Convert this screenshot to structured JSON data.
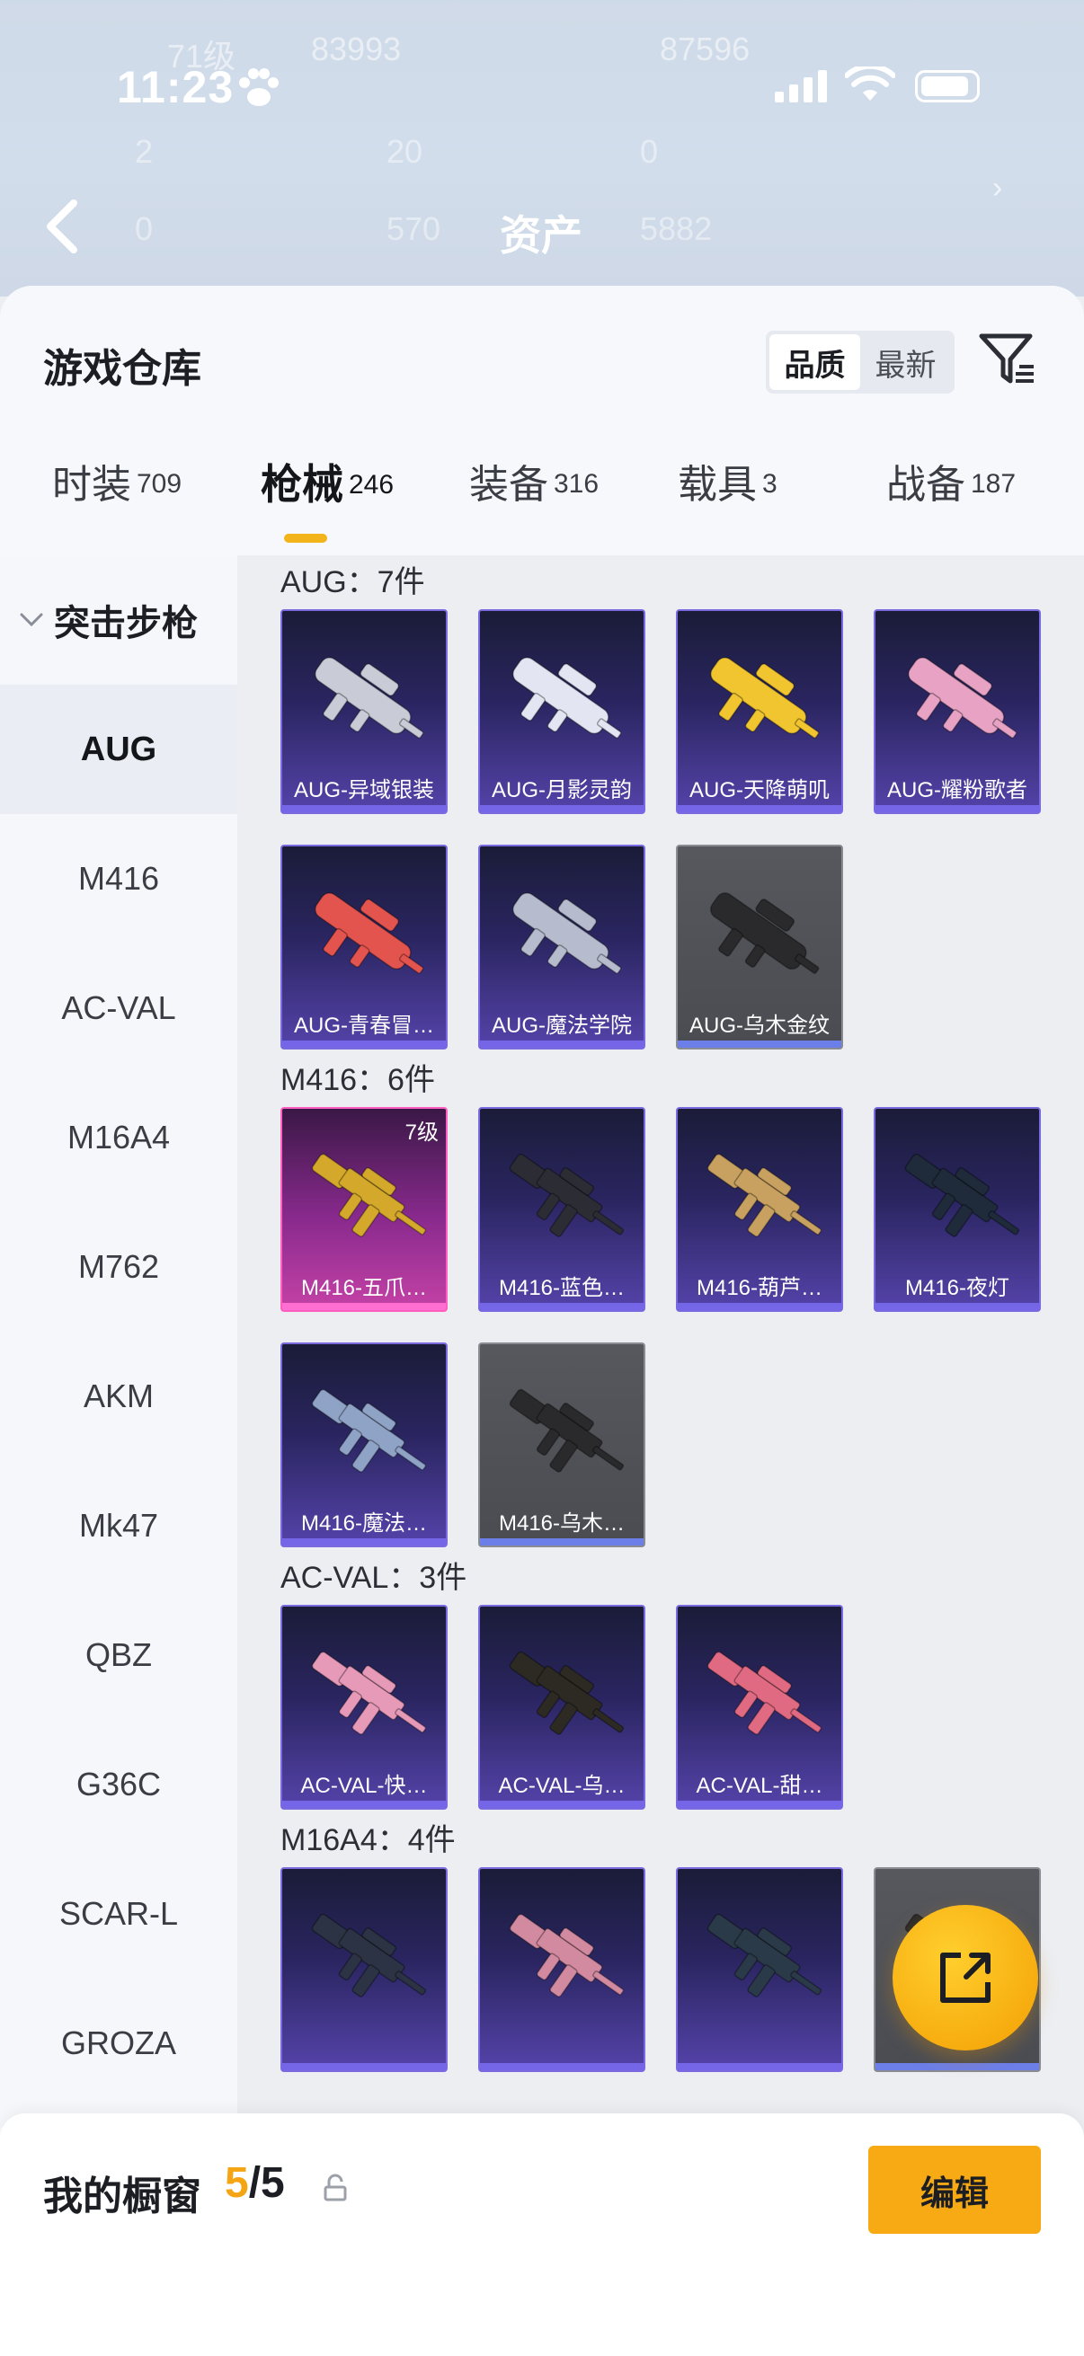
{
  "status_bar": {
    "time": "11:23"
  },
  "background": {
    "level": "71级",
    "stat_a": "83993",
    "stat_b": "87596",
    "row2": [
      "2",
      "20",
      "0"
    ],
    "row3_left": "0",
    "row3_mid": "570",
    "title": "资产",
    "row3_right": "5882"
  },
  "header": {
    "title": "游戏仓库",
    "sort": {
      "options": [
        "品质",
        "最新"
      ],
      "active": "品质"
    },
    "filter_icon": "filter-icon"
  },
  "tabs": [
    {
      "label": "时装",
      "count": "709",
      "active": false
    },
    {
      "label": "枪械",
      "count": "246",
      "active": true
    },
    {
      "label": "装备",
      "count": "316",
      "active": false
    },
    {
      "label": "载具",
      "count": "3",
      "active": false
    },
    {
      "label": "战备",
      "count": "187",
      "active": false
    }
  ],
  "sidebar": {
    "category": "突击步枪",
    "items": [
      "AUG",
      "M416",
      "AC-VAL",
      "M16A4",
      "M762",
      "AKM",
      "Mk47",
      "QBZ",
      "G36C",
      "SCAR-L",
      "GROZA"
    ],
    "active": "AUG"
  },
  "sections": [
    {
      "title": "AUG：7件",
      "items": [
        {
          "label": "AUG-异域银装",
          "rarity": "purple",
          "color": "#c9ccd6"
        },
        {
          "label": "AUG-月影灵韵",
          "rarity": "purple",
          "color": "#e3e6f2"
        },
        {
          "label": "AUG-天降萌叽",
          "rarity": "purple",
          "color": "#f1c530"
        },
        {
          "label": "AUG-耀粉歌者",
          "rarity": "purple",
          "color": "#e7a2c4"
        },
        {
          "label": "AUG-青春冒…",
          "rarity": "purple",
          "color": "#e4544e"
        },
        {
          "label": "AUG-魔法学院",
          "rarity": "purple",
          "color": "#b6bccd"
        },
        {
          "label": "AUG-乌木金纹",
          "rarity": "gray",
          "color": "#2a2a2c"
        }
      ]
    },
    {
      "title": "M416：6件",
      "items": [
        {
          "label": "M416-五爪…",
          "rarity": "pink",
          "level": "7级",
          "color": "#d4a82a"
        },
        {
          "label": "M416-蓝色…",
          "rarity": "purple",
          "color": "#2c2c34"
        },
        {
          "label": "M416-葫芦…",
          "rarity": "purple",
          "color": "#c8a060"
        },
        {
          "label": "M416-夜灯",
          "rarity": "purple",
          "color": "#1f2a3a"
        },
        {
          "label": "M416-魔法…",
          "rarity": "purple",
          "color": "#8fa3c6"
        },
        {
          "label": "M416-乌木…",
          "rarity": "gray",
          "color": "#2a2a2c"
        }
      ]
    },
    {
      "title": "AC-VAL：3件",
      "items": [
        {
          "label": "AC-VAL-快…",
          "rarity": "purple",
          "color": "#e69ab8"
        },
        {
          "label": "AC-VAL-乌…",
          "rarity": "purple",
          "color": "#2c2a22"
        },
        {
          "label": "AC-VAL-甜…",
          "rarity": "purple",
          "color": "#e06a82"
        }
      ]
    },
    {
      "title": "M16A4：4件",
      "items": [
        {
          "label": "",
          "rarity": "purple",
          "color": "#2c3344"
        },
        {
          "label": "",
          "rarity": "purple",
          "color": "#d28aa0"
        },
        {
          "label": "",
          "rarity": "purple",
          "color": "#2a3a48"
        },
        {
          "label": "",
          "rarity": "gray",
          "color": "#2a2a2c"
        }
      ]
    }
  ],
  "fab": {
    "icon": "share-icon"
  },
  "footer": {
    "title": "我的橱窗",
    "current": "5",
    "separator": "/",
    "total": "5",
    "lock_icon": "lock-icon",
    "edit_label": "编辑"
  },
  "colors": {
    "accent": "#f7aa14",
    "tab_underline": "#f3b41b",
    "purple_card": "#5543aa",
    "pink_card": "#c542a6"
  }
}
